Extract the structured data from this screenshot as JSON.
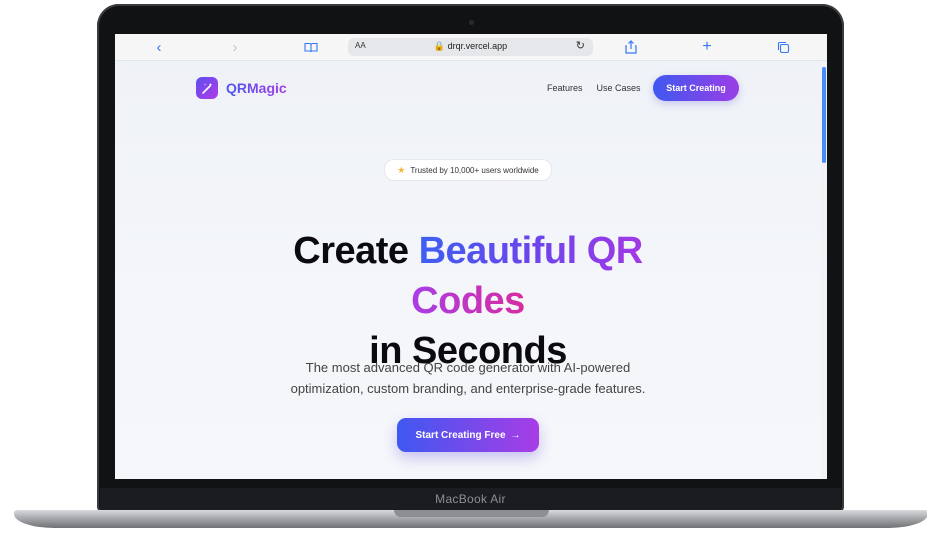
{
  "browser": {
    "text_size_label": "AA",
    "url": "🔒 drqr.vercel.app",
    "icons": [
      "back-icon",
      "forward-icon",
      "reader-icon",
      "reload-icon",
      "share-icon",
      "new-tab-icon",
      "tabs-icon"
    ]
  },
  "brand": {
    "name": "QRMagic",
    "icon": "magic-wand-icon"
  },
  "nav": {
    "features": "Features",
    "use_cases": "Use Cases",
    "cta": "Start Creating"
  },
  "hero": {
    "badge": "Trusted by 10,000+ users worldwide",
    "line1_plain": "Create ",
    "line1_accent": "Beautiful QR",
    "line2_accent": "Codes",
    "line3": "in Seconds",
    "subtitle_1": "The most advanced QR code generator with AI-powered",
    "subtitle_2": "optimization, custom branding, and enterprise-grade features.",
    "cta": "Start Creating Free",
    "cta_arrow": "→"
  },
  "device": {
    "label": "MacBook Air"
  },
  "colors": {
    "accent_blue": "#3f58f0",
    "accent_purple": "#a338e5",
    "accent_pink": "#d82c9f",
    "link_blue": "#3478f6"
  }
}
